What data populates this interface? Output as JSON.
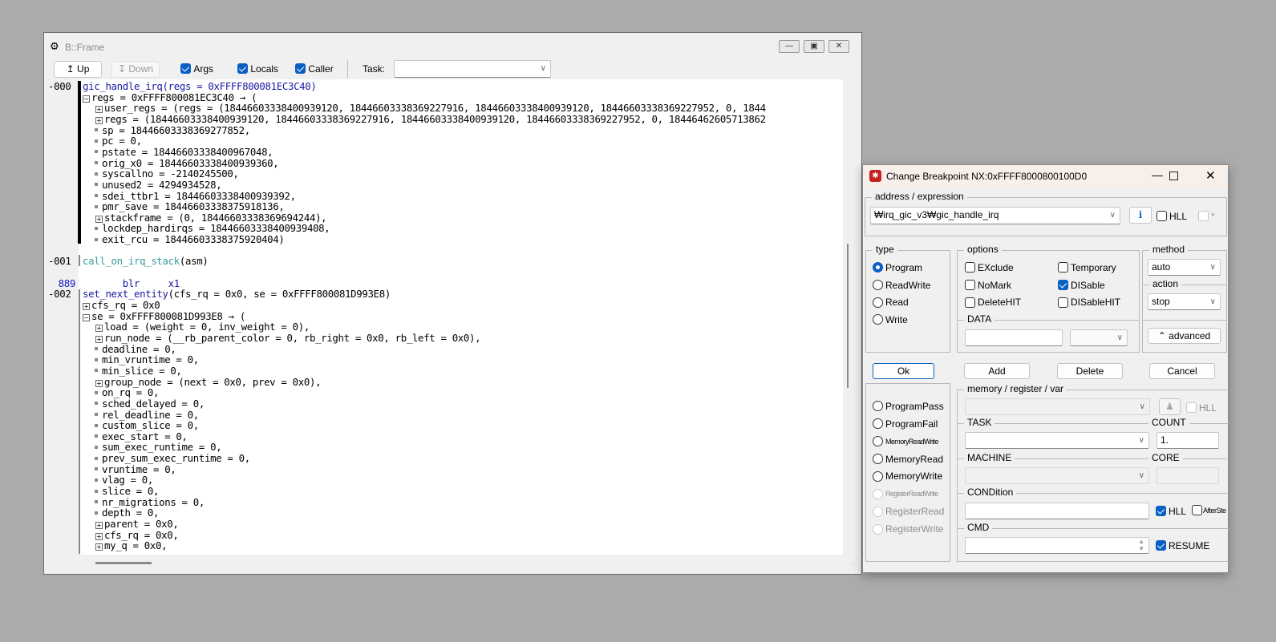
{
  "frame": {
    "title": "B::Frame",
    "toolbar": {
      "up": "Up",
      "down": "Down",
      "args": "Args",
      "locals": "Locals",
      "caller": "Caller",
      "task_label": "Task:",
      "task_value": ""
    },
    "lines": [
      {
        "num": "-000",
        "ind": 0,
        "mk": "",
        "text": "gic_handle_irq",
        "cls": "fn-blue",
        "rest": "(regs = 0xFFFF800081EC3C40)",
        "restcls": "fn-blue"
      },
      {
        "num": "",
        "ind": 0,
        "mk": "minus",
        "text": "regs = 0xFFFF800081EC3C40 → ("
      },
      {
        "num": "",
        "ind": 1,
        "mk": "plus",
        "text": "user_regs = (regs = (18446603338400939120, 18446603338369227916, 18446603338400939120, 18446603338369227952, 0, 1844"
      },
      {
        "num": "",
        "ind": 1,
        "mk": "plus",
        "text": "regs = (18446603338400939120, 18446603338369227916, 18446603338400939120, 18446603338369227952, 0, 18446462605713862"
      },
      {
        "num": "",
        "ind": 1,
        "mk": "dot",
        "text": "sp = 18446603338369277852,"
      },
      {
        "num": "",
        "ind": 1,
        "mk": "dot",
        "text": "pc = 0,"
      },
      {
        "num": "",
        "ind": 1,
        "mk": "dot",
        "text": "pstate = 18446603338400967048,"
      },
      {
        "num": "",
        "ind": 1,
        "mk": "dot",
        "text": "orig_x0 = 18446603338400939360,"
      },
      {
        "num": "",
        "ind": 1,
        "mk": "dot",
        "text": "syscallno = -2140245500,"
      },
      {
        "num": "",
        "ind": 1,
        "mk": "dot",
        "text": "unused2 = 4294934528,"
      },
      {
        "num": "",
        "ind": 1,
        "mk": "dot",
        "text": "sdei_ttbr1 = 18446603338400939392,"
      },
      {
        "num": "",
        "ind": 1,
        "mk": "dot",
        "text": "pmr_save = 18446603338375918136,"
      },
      {
        "num": "",
        "ind": 1,
        "mk": "plus",
        "text": "stackframe = (0, 18446603338369694244),"
      },
      {
        "num": "",
        "ind": 1,
        "mk": "dot",
        "text": "lockdep_hardirqs = 18446603338400939408,"
      },
      {
        "num": "",
        "ind": 1,
        "mk": "dot",
        "text": "exit_rcu = 18446603338375920404)"
      },
      {
        "num": "",
        "ind": 0,
        "mk": "",
        "text": ""
      },
      {
        "num": "-001",
        "ind": 0,
        "mk": "",
        "text": "call_on_irq_stack",
        "cls": "fn-teal",
        "rest": "(asm)"
      },
      {
        "num": "",
        "ind": 0,
        "mk": "",
        "text": ""
      },
      {
        "num": "889",
        "ind": 0,
        "mk": "",
        "text": "       blr     x1",
        "cls": "asm",
        "numblue": true
      },
      {
        "num": "-002",
        "ind": 0,
        "mk": "",
        "text": "set_next_entity",
        "cls": "fn-blue",
        "rest": "(cfs_rq = 0x0, se = 0xFFFF800081D993E8)"
      },
      {
        "num": "",
        "ind": 0,
        "mk": "plus",
        "text": "cfs_rq = 0x0"
      },
      {
        "num": "",
        "ind": 0,
        "mk": "minus",
        "text": "se = 0xFFFF800081D993E8 → ("
      },
      {
        "num": "",
        "ind": 1,
        "mk": "plus",
        "text": "load = (weight = 0, inv_weight = 0),"
      },
      {
        "num": "",
        "ind": 1,
        "mk": "plus",
        "text": "run_node = (__rb_parent_color = 0, rb_right = 0x0, rb_left = 0x0),"
      },
      {
        "num": "",
        "ind": 1,
        "mk": "dot",
        "text": "deadline = 0,"
      },
      {
        "num": "",
        "ind": 1,
        "mk": "dot",
        "text": "min_vruntime = 0,"
      },
      {
        "num": "",
        "ind": 1,
        "mk": "dot",
        "text": "min_slice = 0,"
      },
      {
        "num": "",
        "ind": 1,
        "mk": "plus",
        "text": "group_node = (next = 0x0, prev = 0x0),"
      },
      {
        "num": "",
        "ind": 1,
        "mk": "dot",
        "text": "on_rq = 0,"
      },
      {
        "num": "",
        "ind": 1,
        "mk": "dot",
        "text": "sched_delayed = 0,"
      },
      {
        "num": "",
        "ind": 1,
        "mk": "dot",
        "text": "rel_deadline = 0,"
      },
      {
        "num": "",
        "ind": 1,
        "mk": "dot",
        "text": "custom_slice = 0,"
      },
      {
        "num": "",
        "ind": 1,
        "mk": "dot",
        "text": "exec_start = 0,"
      },
      {
        "num": "",
        "ind": 1,
        "mk": "dot",
        "text": "sum_exec_runtime = 0,"
      },
      {
        "num": "",
        "ind": 1,
        "mk": "dot",
        "text": "prev_sum_exec_runtime = 0,"
      },
      {
        "num": "",
        "ind": 1,
        "mk": "dot",
        "text": "vruntime = 0,"
      },
      {
        "num": "",
        "ind": 1,
        "mk": "dot",
        "text": "vlag = 0,"
      },
      {
        "num": "",
        "ind": 1,
        "mk": "dot",
        "text": "slice = 0,"
      },
      {
        "num": "",
        "ind": 1,
        "mk": "dot",
        "text": "nr_migrations = 0,"
      },
      {
        "num": "",
        "ind": 1,
        "mk": "dot",
        "text": "depth = 0,"
      },
      {
        "num": "",
        "ind": 1,
        "mk": "plus",
        "text": "parent = 0x0,"
      },
      {
        "num": "",
        "ind": 1,
        "mk": "plus",
        "text": "cfs_rq = 0x0,"
      },
      {
        "num": "",
        "ind": 1,
        "mk": "plus",
        "text": "my_q = 0x0,"
      }
    ]
  },
  "dialog": {
    "title": "Change Breakpoint  NX:0xFFFF8000800100D0",
    "address_group": "address / expression",
    "address_value": "₩irq_gic_v3₩gic_handle_irq",
    "hll": "HLL",
    "star": "*",
    "type_group": "type",
    "types": [
      "Program",
      "ReadWrite",
      "Read",
      "Write"
    ],
    "options_group": "options",
    "options": [
      {
        "label": "EXclude",
        "on": false
      },
      {
        "label": "Temporary",
        "on": false
      },
      {
        "label": "NoMark",
        "on": false
      },
      {
        "label": "DISable",
        "on": true
      },
      {
        "label": "DeleteHIT",
        "on": false
      },
      {
        "label": "DISableHIT",
        "on": false
      }
    ],
    "data_group": "DATA",
    "method_group": "method",
    "method_value": "auto",
    "action_group": "action",
    "action_value": "stop",
    "advanced": "advanced",
    "ok": "Ok",
    "add": "Add",
    "delete": "Delete",
    "cancel": "Cancel",
    "types2": [
      "ProgramPass",
      "ProgramFail",
      "MemoryReadWrite",
      "MemoryRead",
      "MemoryWrite",
      "RegisterReadWrite",
      "RegisterRead",
      "RegisterWrite"
    ],
    "mem_group": "memory / register / var",
    "mem_hll": "HLL",
    "task_label": "TASK",
    "count_label": "COUNT",
    "count_value": "1.",
    "machine_label": "MACHINE",
    "core_label": "CORE",
    "condition_label": "CONDition",
    "cond_hll": "HLL",
    "afterstep": "AfterSte",
    "cmd_label": "CMD",
    "resume": "RESUME"
  }
}
